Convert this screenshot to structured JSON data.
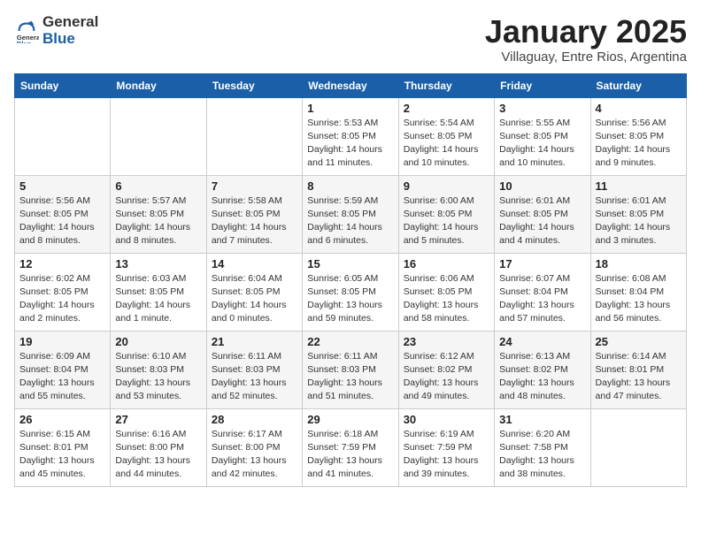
{
  "header": {
    "logo_general": "General",
    "logo_blue": "Blue",
    "title": "January 2025",
    "subtitle": "Villaguay, Entre Rios, Argentina"
  },
  "days_of_week": [
    "Sunday",
    "Monday",
    "Tuesday",
    "Wednesday",
    "Thursday",
    "Friday",
    "Saturday"
  ],
  "weeks": [
    [
      {
        "day": "",
        "info": ""
      },
      {
        "day": "",
        "info": ""
      },
      {
        "day": "",
        "info": ""
      },
      {
        "day": "1",
        "info": "Sunrise: 5:53 AM\nSunset: 8:05 PM\nDaylight: 14 hours and 11 minutes."
      },
      {
        "day": "2",
        "info": "Sunrise: 5:54 AM\nSunset: 8:05 PM\nDaylight: 14 hours and 10 minutes."
      },
      {
        "day": "3",
        "info": "Sunrise: 5:55 AM\nSunset: 8:05 PM\nDaylight: 14 hours and 10 minutes."
      },
      {
        "day": "4",
        "info": "Sunrise: 5:56 AM\nSunset: 8:05 PM\nDaylight: 14 hours and 9 minutes."
      }
    ],
    [
      {
        "day": "5",
        "info": "Sunrise: 5:56 AM\nSunset: 8:05 PM\nDaylight: 14 hours and 8 minutes."
      },
      {
        "day": "6",
        "info": "Sunrise: 5:57 AM\nSunset: 8:05 PM\nDaylight: 14 hours and 8 minutes."
      },
      {
        "day": "7",
        "info": "Sunrise: 5:58 AM\nSunset: 8:05 PM\nDaylight: 14 hours and 7 minutes."
      },
      {
        "day": "8",
        "info": "Sunrise: 5:59 AM\nSunset: 8:05 PM\nDaylight: 14 hours and 6 minutes."
      },
      {
        "day": "9",
        "info": "Sunrise: 6:00 AM\nSunset: 8:05 PM\nDaylight: 14 hours and 5 minutes."
      },
      {
        "day": "10",
        "info": "Sunrise: 6:01 AM\nSunset: 8:05 PM\nDaylight: 14 hours and 4 minutes."
      },
      {
        "day": "11",
        "info": "Sunrise: 6:01 AM\nSunset: 8:05 PM\nDaylight: 14 hours and 3 minutes."
      }
    ],
    [
      {
        "day": "12",
        "info": "Sunrise: 6:02 AM\nSunset: 8:05 PM\nDaylight: 14 hours and 2 minutes."
      },
      {
        "day": "13",
        "info": "Sunrise: 6:03 AM\nSunset: 8:05 PM\nDaylight: 14 hours and 1 minute."
      },
      {
        "day": "14",
        "info": "Sunrise: 6:04 AM\nSunset: 8:05 PM\nDaylight: 14 hours and 0 minutes."
      },
      {
        "day": "15",
        "info": "Sunrise: 6:05 AM\nSunset: 8:05 PM\nDaylight: 13 hours and 59 minutes."
      },
      {
        "day": "16",
        "info": "Sunrise: 6:06 AM\nSunset: 8:05 PM\nDaylight: 13 hours and 58 minutes."
      },
      {
        "day": "17",
        "info": "Sunrise: 6:07 AM\nSunset: 8:04 PM\nDaylight: 13 hours and 57 minutes."
      },
      {
        "day": "18",
        "info": "Sunrise: 6:08 AM\nSunset: 8:04 PM\nDaylight: 13 hours and 56 minutes."
      }
    ],
    [
      {
        "day": "19",
        "info": "Sunrise: 6:09 AM\nSunset: 8:04 PM\nDaylight: 13 hours and 55 minutes."
      },
      {
        "day": "20",
        "info": "Sunrise: 6:10 AM\nSunset: 8:03 PM\nDaylight: 13 hours and 53 minutes."
      },
      {
        "day": "21",
        "info": "Sunrise: 6:11 AM\nSunset: 8:03 PM\nDaylight: 13 hours and 52 minutes."
      },
      {
        "day": "22",
        "info": "Sunrise: 6:11 AM\nSunset: 8:03 PM\nDaylight: 13 hours and 51 minutes."
      },
      {
        "day": "23",
        "info": "Sunrise: 6:12 AM\nSunset: 8:02 PM\nDaylight: 13 hours and 49 minutes."
      },
      {
        "day": "24",
        "info": "Sunrise: 6:13 AM\nSunset: 8:02 PM\nDaylight: 13 hours and 48 minutes."
      },
      {
        "day": "25",
        "info": "Sunrise: 6:14 AM\nSunset: 8:01 PM\nDaylight: 13 hours and 47 minutes."
      }
    ],
    [
      {
        "day": "26",
        "info": "Sunrise: 6:15 AM\nSunset: 8:01 PM\nDaylight: 13 hours and 45 minutes."
      },
      {
        "day": "27",
        "info": "Sunrise: 6:16 AM\nSunset: 8:00 PM\nDaylight: 13 hours and 44 minutes."
      },
      {
        "day": "28",
        "info": "Sunrise: 6:17 AM\nSunset: 8:00 PM\nDaylight: 13 hours and 42 minutes."
      },
      {
        "day": "29",
        "info": "Sunrise: 6:18 AM\nSunset: 7:59 PM\nDaylight: 13 hours and 41 minutes."
      },
      {
        "day": "30",
        "info": "Sunrise: 6:19 AM\nSunset: 7:59 PM\nDaylight: 13 hours and 39 minutes."
      },
      {
        "day": "31",
        "info": "Sunrise: 6:20 AM\nSunset: 7:58 PM\nDaylight: 13 hours and 38 minutes."
      },
      {
        "day": "",
        "info": ""
      }
    ]
  ]
}
